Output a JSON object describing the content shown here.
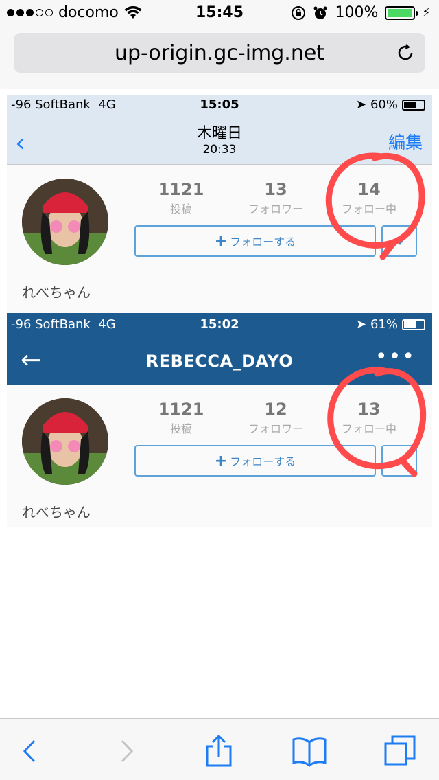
{
  "status_bar": {
    "carrier": "docomo",
    "time": "15:45",
    "battery_pct": "100%",
    "signal_filled": 3,
    "signal_total": 5
  },
  "browser": {
    "url": "up-origin.gc-img.net"
  },
  "embedded": {
    "shot1": {
      "status": {
        "carrier": "-96 SoftBank",
        "network": "4G",
        "time": "15:05",
        "battery": "60%",
        "battery_level": 0.6
      },
      "nav": {
        "title": "木曜日",
        "subtitle": "20:33",
        "edit": "編集"
      },
      "profile": {
        "posts": {
          "num": "1121",
          "label": "投稿"
        },
        "followers": {
          "num": "13",
          "label": "フォロワー"
        },
        "following": {
          "num": "14",
          "label": "フォロー中"
        },
        "follow_button": "フォローする",
        "name": "れべちゃん"
      }
    },
    "shot2": {
      "status": {
        "carrier": "-96 SoftBank",
        "network": "4G",
        "time": "15:02",
        "battery": "61%",
        "battery_level": 0.61
      },
      "nav": {
        "title": "REBECCA_DAYO",
        "more": "•••"
      },
      "profile": {
        "posts": {
          "num": "1121",
          "label": "投稿"
        },
        "followers": {
          "num": "12",
          "label": "フォロワー"
        },
        "following": {
          "num": "13",
          "label": "フォロー中"
        },
        "follow_button": "フォローする",
        "name": "れべちゃん"
      }
    }
  },
  "colors": {
    "accent_blue": "#1e7cf5",
    "nav_dark": "#1d5a8f",
    "annotation_red": "#ff4b4b"
  }
}
